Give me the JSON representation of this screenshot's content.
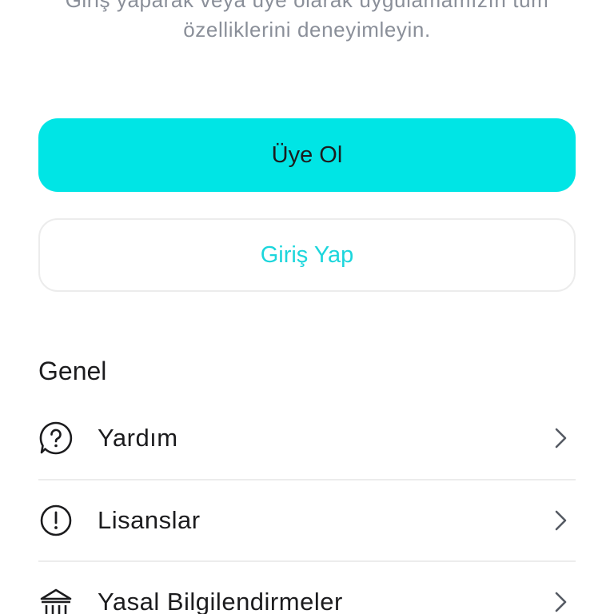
{
  "intro": {
    "line1": "Giriş yaparak veya üye olarak uygulamamızın tüm",
    "line2": "özelliklerini deneyimleyin."
  },
  "buttons": {
    "signup_label": "Üye Ol",
    "login_label": "Giriş Yap"
  },
  "colors": {
    "accent": "#00e5e5",
    "accent_text": "#1cd6dc",
    "muted_text": "#8a8f99"
  },
  "general": {
    "title": "Genel",
    "items": [
      {
        "label": "Yardım",
        "icon": "help-icon"
      },
      {
        "label": "Lisanslar",
        "icon": "info-icon"
      },
      {
        "label": "Yasal Bilgilendirmeler",
        "icon": "bank-icon"
      }
    ]
  }
}
